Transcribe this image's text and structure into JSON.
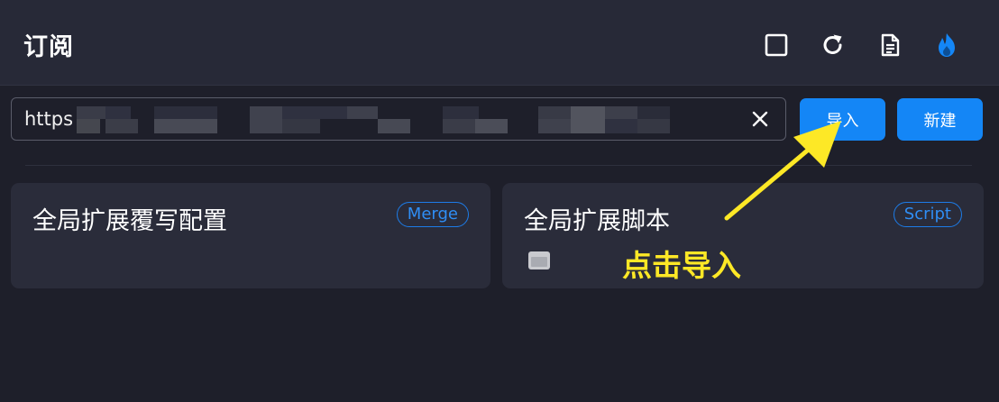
{
  "header": {
    "title": "订阅",
    "icons": [
      "square-icon",
      "refresh-icon",
      "document-icon",
      "flame-icon"
    ]
  },
  "url_field": {
    "value": "https",
    "clear_icon": "close-icon"
  },
  "buttons": {
    "import_label": "导入",
    "new_label": "新建"
  },
  "cards": [
    {
      "title": "全局扩展覆写配置",
      "badge": "Merge"
    },
    {
      "title": "全局扩展脚本",
      "badge": "Script",
      "icon": "terminal-icon"
    }
  ],
  "annotation": {
    "label": "点击导入"
  },
  "colors": {
    "accent": "#1486f6",
    "background": "#1e1f2a",
    "header": "#272937",
    "card": "#2a2c3a",
    "annotation": "#fde826"
  }
}
